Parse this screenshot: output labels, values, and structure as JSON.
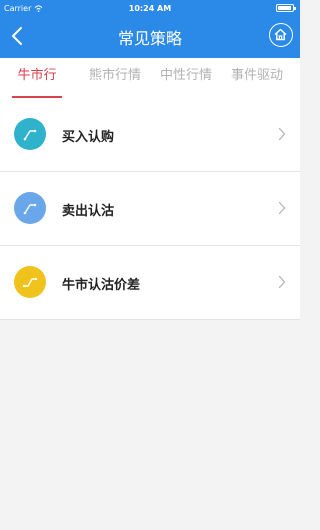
{
  "status_bar": {
    "carrier": "Carrier",
    "time": "10:24 AM"
  },
  "header": {
    "title": "常见策略"
  },
  "tabs": [
    {
      "label": "牛市行情",
      "active": true
    },
    {
      "label": "熊市行情",
      "active": false
    },
    {
      "label": "中性行情",
      "active": false
    },
    {
      "label": "事件驱动",
      "active": false
    }
  ],
  "strategies": [
    {
      "label": "买入认购",
      "icon": "trend-up-icon",
      "color": "#2fb2cc"
    },
    {
      "label": "卖出认沽",
      "icon": "trend-up-icon",
      "color": "#6aa7ea"
    },
    {
      "label": "牛市认沽价差",
      "icon": "bull-put-spread-icon",
      "color": "#f0c21c"
    }
  ],
  "colors": {
    "header_bg": "#2b8ae8",
    "active_tab": "#d9414b",
    "inactive_tab": "#b2b2b2",
    "page_bg": "#f3f3f3"
  }
}
